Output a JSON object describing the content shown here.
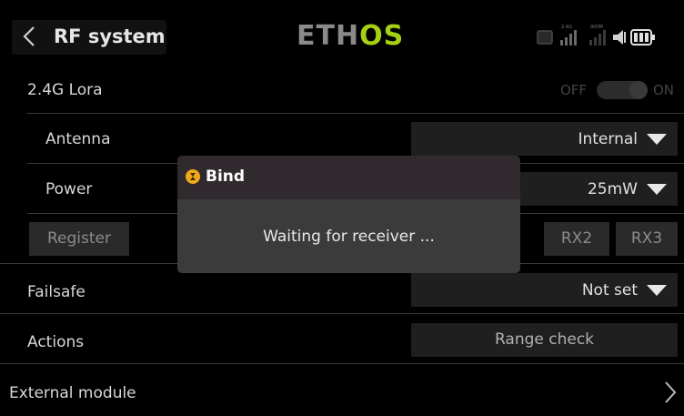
{
  "header": {
    "title": "RF system",
    "logo_main": "ETH",
    "logo_accent": "OS",
    "status_labels": [
      "2.4G",
      "900M"
    ]
  },
  "lora": {
    "label": "2.4G Lora",
    "toggle_off": "OFF",
    "toggle_on": "ON",
    "state": "on"
  },
  "antenna": {
    "label": "Antenna",
    "value": "Internal"
  },
  "power": {
    "label": "Power",
    "value": "25mW"
  },
  "register": {
    "label": "Register"
  },
  "receivers": [
    "RX2",
    "RX3"
  ],
  "failsafe": {
    "label": "Failsafe",
    "value": "Not set"
  },
  "actions": {
    "label": "Actions",
    "value": "Range check"
  },
  "external": {
    "label": "External module"
  },
  "dialog": {
    "title": "Bind",
    "message": "Waiting for receiver ..."
  },
  "colors": {
    "accent": "#a5d014",
    "dialog_icon": "#f0a81a"
  }
}
